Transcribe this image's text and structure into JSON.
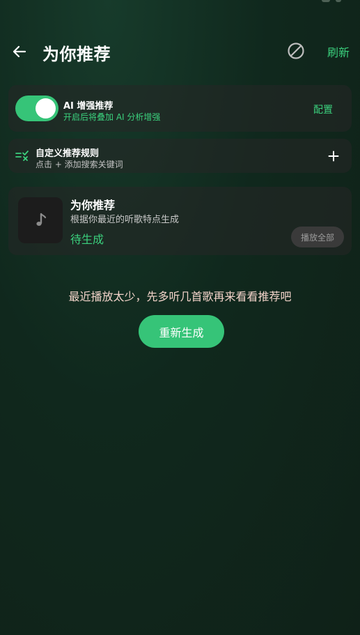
{
  "header": {
    "title": "为你推荐",
    "refresh_label": "刷新"
  },
  "ai_card": {
    "title": "AI 增强推荐",
    "subtitle": "开启后将叠加 AI 分析增强",
    "config_label": "配置",
    "enabled": true
  },
  "rules_card": {
    "title": "自定义推荐规则",
    "subtitle": "点击 + 添加搜索关键词"
  },
  "recommend_card": {
    "title": "为你推荐",
    "subtitle": "根据你最近的听歌特点生成",
    "status": "待生成",
    "play_all_label": "播放全部"
  },
  "empty_state": {
    "message": "最近播放太少，先多听几首歌再来看看推荐吧",
    "regenerate_label": "重新生成"
  },
  "icons": {
    "back": "arrow-left-icon",
    "block": "block-icon",
    "rules": "list-check-icon",
    "add": "plus-icon",
    "cover": "music-note-icon"
  },
  "colors": {
    "accent": "#36c478",
    "accent_text": "#3bd07d",
    "background": "#10281d",
    "card": "#262626"
  }
}
